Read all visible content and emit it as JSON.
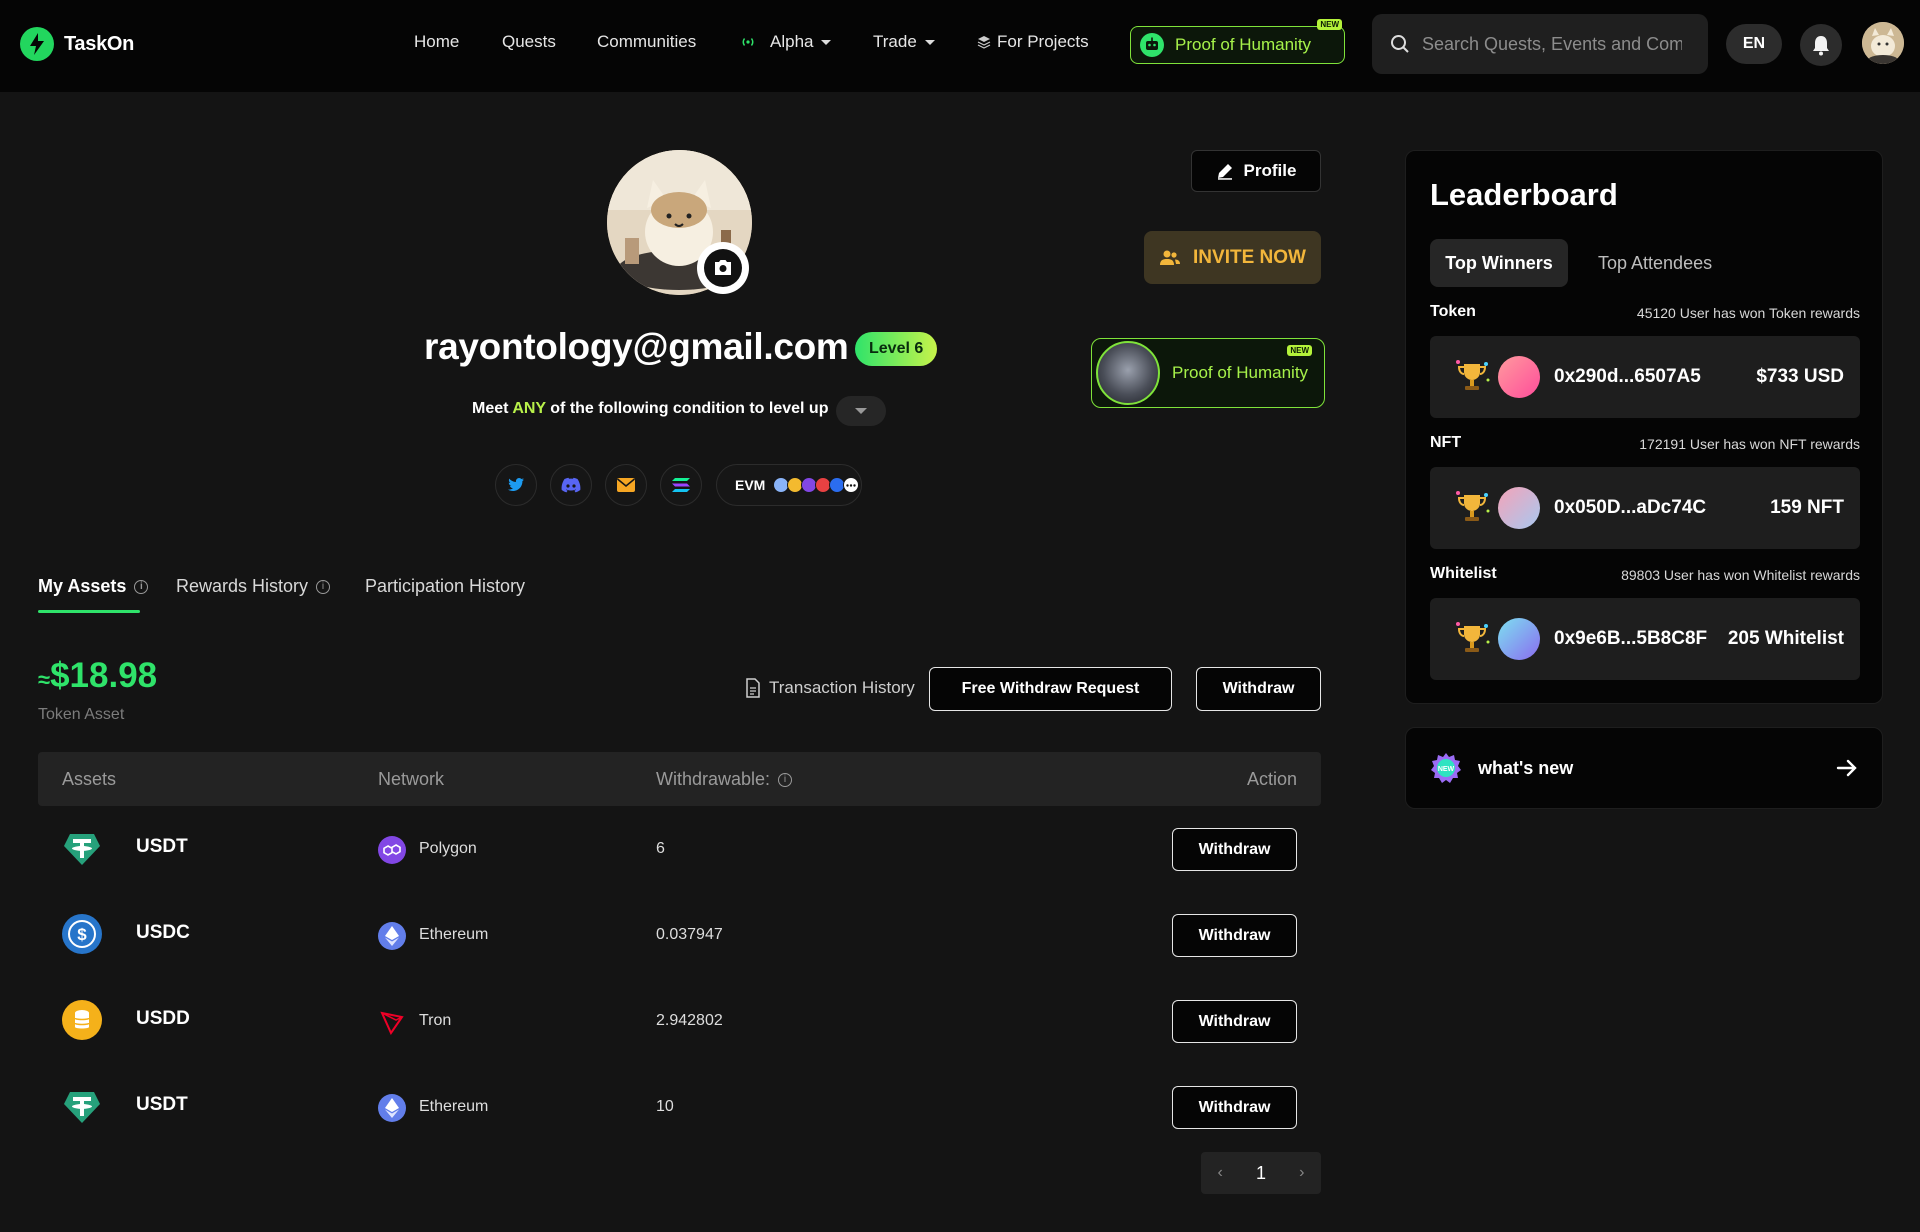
{
  "header": {
    "brand": "TaskOn",
    "nav": [
      {
        "label": "Home"
      },
      {
        "label": "Quests"
      },
      {
        "label": "Communities"
      },
      {
        "label": "Alpha"
      },
      {
        "label": "Trade"
      },
      {
        "label": "For Projects"
      }
    ],
    "poh_label": "Proof of Humanity",
    "new_badge": "NEW",
    "search_placeholder": "Search Quests, Events and Communities",
    "lang": "EN"
  },
  "profile": {
    "email": "rayontology@gmail.com",
    "level": "Level 6",
    "levelup_prefix": "Meet",
    "levelup_any": "ANY",
    "levelup_suffix": "of the following condition to level up",
    "evm_label": "EVM",
    "profile_btn": "Profile",
    "invite_btn": "INVITE NOW",
    "poh_card_label": "Proof of Humanity",
    "poh_new": "NEW"
  },
  "tabs": [
    {
      "label": "My Assets"
    },
    {
      "label": "Rewards History"
    },
    {
      "label": "Participation History"
    }
  ],
  "assets": {
    "approx": "≈",
    "balance": "$18.98",
    "balance_label": "Token Asset",
    "txn_history": "Transaction History",
    "free_withdraw": "Free Withdraw Request",
    "withdraw": "Withdraw",
    "columns": {
      "assets": "Assets",
      "network": "Network",
      "withdrawable": "Withdrawable:",
      "action": "Action"
    },
    "rows": [
      {
        "coin": "USDT",
        "network": "Polygon",
        "amount": "6",
        "action": "Withdraw"
      },
      {
        "coin": "USDC",
        "network": "Ethereum",
        "amount": "0.037947",
        "action": "Withdraw"
      },
      {
        "coin": "USDD",
        "network": "Tron",
        "amount": "2.942802",
        "action": "Withdraw"
      },
      {
        "coin": "USDT",
        "network": "Ethereum",
        "amount": "10",
        "action": "Withdraw"
      }
    ],
    "page": "1"
  },
  "leaderboard": {
    "title": "Leaderboard",
    "tab_active": "Top Winners",
    "tab_other": "Top Attendees",
    "sections": [
      {
        "name": "Token",
        "count": "45120 User has won Token rewards",
        "addr": "0x290d...6507A5",
        "prize": "$733 USD"
      },
      {
        "name": "NFT",
        "count": "172191 User has won NFT rewards",
        "addr": "0x050D...aDc74C",
        "prize": "159 NFT"
      },
      {
        "name": "Whitelist",
        "count": "89803 User has won Whitelist rewards",
        "addr": "0x9e6B...5B8C8F",
        "prize": "205 Whitelist"
      }
    ]
  },
  "whats_new": {
    "label": "what's new",
    "badge": "NEW"
  },
  "colors": {
    "accent": "#2fe36a",
    "lime": "#a6f14a",
    "gold": "#f2b63b",
    "bg": "#141414"
  }
}
